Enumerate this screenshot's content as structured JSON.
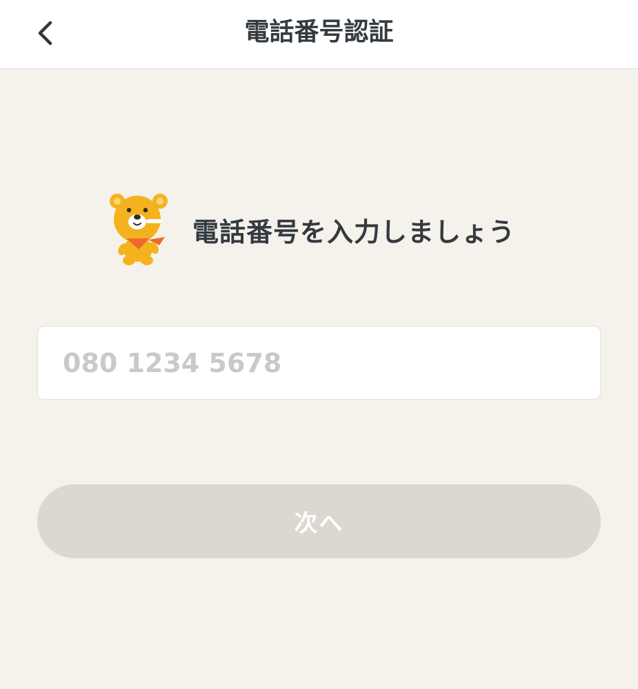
{
  "header": {
    "title": "電話番号認証",
    "back_icon": "chevron-left-icon"
  },
  "intro": {
    "mascot": "bear-mascot",
    "text": "電話番号を入力しましょう"
  },
  "phone": {
    "value": "",
    "placeholder": "080 1234 5678"
  },
  "next_button": {
    "label": "次へ",
    "state": "disabled"
  },
  "colors": {
    "background": "#f5f2eb",
    "header_bg": "#ffffff",
    "text": "#333a40",
    "placeholder": "#c9c9c9",
    "button_disabled": "#dbd8d0",
    "mascot_body": "#f5b21f",
    "mascot_scarf": "#ee6a2c"
  }
}
